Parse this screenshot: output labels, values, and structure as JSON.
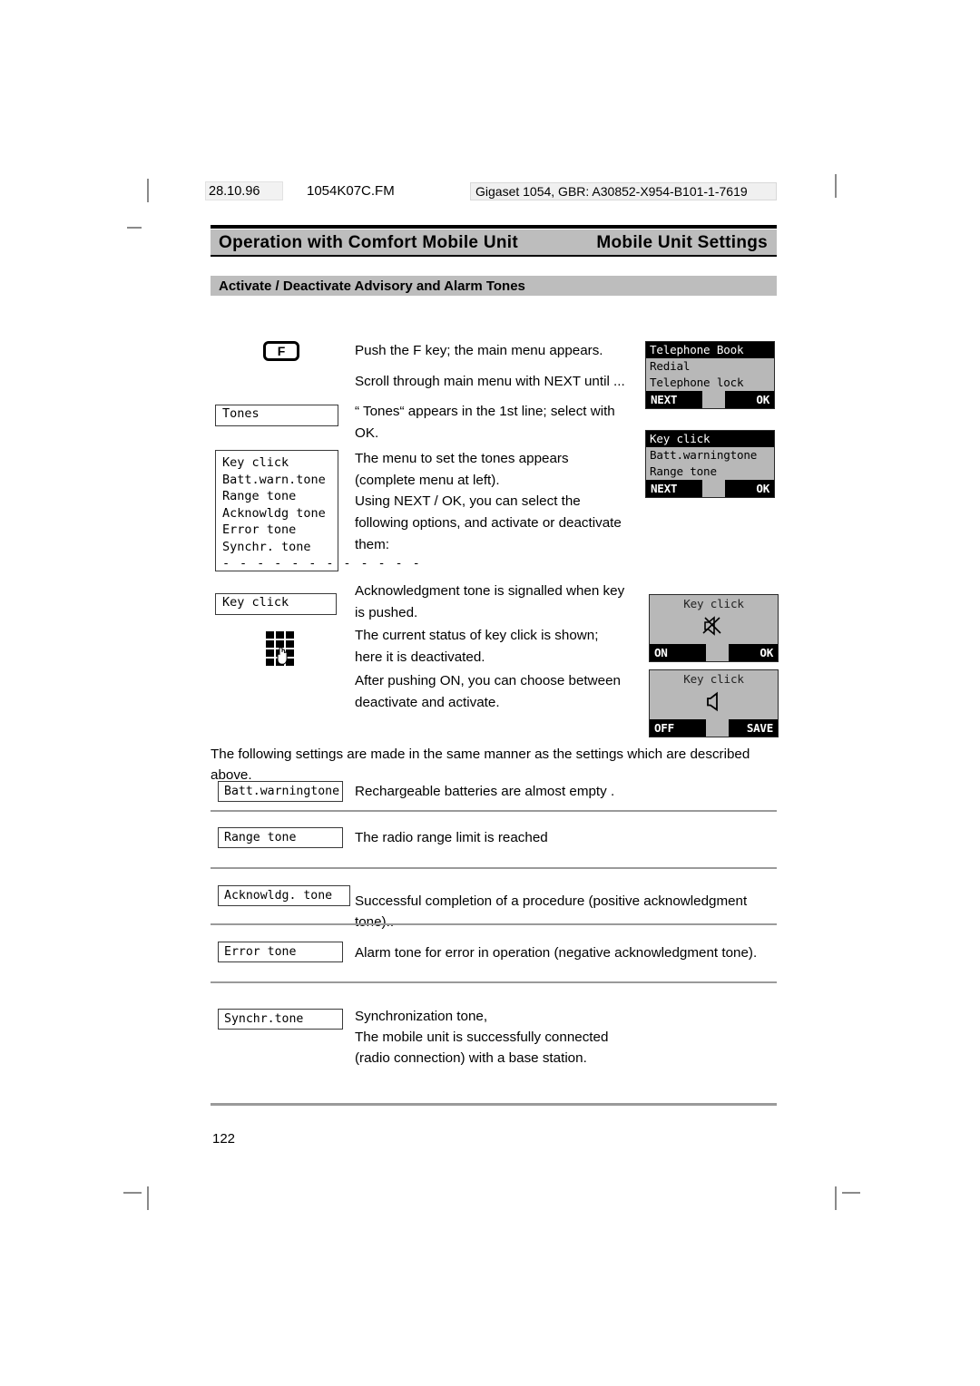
{
  "header": {
    "date": "28.10.96",
    "filename": "1054K07C.FM",
    "identifier": "Gigaset 1054, GBR: A30852-X954-B101-1-7619"
  },
  "running_head": {
    "left": "Operation with Comfort Mobile Unit",
    "right": "Mobile Unit Settings"
  },
  "section": {
    "title": "Activate / Deactivate Advisory and Alarm Tones"
  },
  "steps": {
    "fkey_label": "F",
    "p1": "Push the F key; the main menu appears.",
    "p2": "Scroll through main menu with NEXT until ...",
    "p3": "“ Tones“ appears in the 1st line; select with OK.",
    "p4": "The menu to set the tones  appears (complete menu at left).",
    "p5": "Using NEXT / OK, you can select the following options, and activate or deactivate them:",
    "p6": "Acknowledgment tone is signalled when key is pushed.",
    "p7": "The current status of key click is shown; here it is deactivated.",
    "p8": "After pushing ON, you can choose between deactivate and activate."
  },
  "left_boxes": {
    "tones": "Tones",
    "menu": [
      "Key click",
      "Batt.warn.tone",
      "Range tone",
      "Acknowldg tone",
      "Error tone",
      "Synchr. tone"
    ],
    "menu_dashes": "- - - - - - - - - - - -",
    "key_click": "Key click"
  },
  "displays": [
    {
      "name": "telephone-book",
      "title": "Telephone Book",
      "rows": [
        "Redial",
        "Telephone lock"
      ],
      "softkey_left": "NEXT",
      "softkey_right": "OK"
    },
    {
      "name": "key-click-menu",
      "title": "Key click",
      "rows": [
        "Batt.warningtone",
        "Range tone"
      ],
      "softkey_left": "NEXT",
      "softkey_right": "OK"
    },
    {
      "name": "key-click-off",
      "title": "Key click",
      "icon": "speaker-muted-icon",
      "softkey_left": "ON",
      "softkey_right": "OK"
    },
    {
      "name": "key-click-on",
      "title": "Key click",
      "icon": "speaker-icon",
      "softkey_left": "OFF",
      "softkey_right": "SAVE"
    }
  ],
  "lower": {
    "intro": "The following settings are made in the same manner as the settings which are described above.",
    "rows": [
      {
        "label": "Batt.warningtone",
        "text": "Rechargeable batteries are almost empty ."
      },
      {
        "label": "Range tone",
        "text": "The radio range limit is reached"
      },
      {
        "label": "Acknowldg. tone",
        "text": "Successful completion of a procedure (positive acknowledgment tone).."
      },
      {
        "label": "Error tone",
        "text": "Alarm tone for error in operation (negative acknowledgment tone)."
      },
      {
        "label": "Synchr.tone",
        "text": "Synchronization tone,\nThe mobile unit is successfully connected\n(radio connection) with a base station."
      }
    ]
  },
  "footer": {
    "page_number": "122"
  },
  "colors": {
    "band_gray": "#bdbdbd",
    "lcd_gray": "#b8b8b8",
    "rule_gray": "#9a9a9a"
  }
}
